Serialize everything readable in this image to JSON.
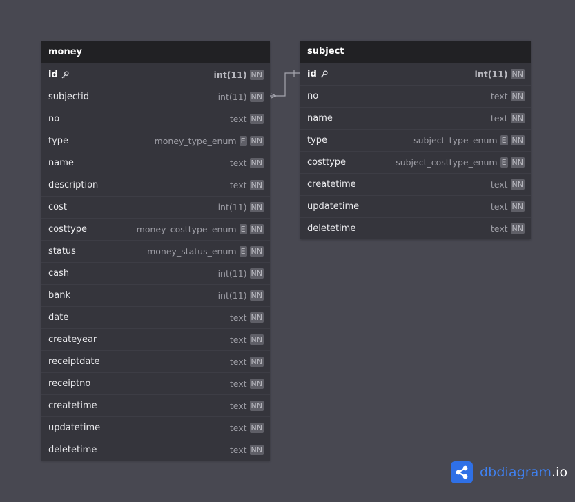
{
  "tables": [
    {
      "id": "money",
      "name": "money",
      "fields": [
        {
          "name": "id",
          "type": "int(11)",
          "pk": true,
          "enum": false,
          "nn": "NN"
        },
        {
          "name": "subjectid",
          "type": "int(11)",
          "pk": false,
          "enum": false,
          "nn": "NN"
        },
        {
          "name": "no",
          "type": "text",
          "pk": false,
          "enum": false,
          "nn": "NN"
        },
        {
          "name": "type",
          "type": "money_type_enum",
          "pk": false,
          "enum": true,
          "nn": "NN"
        },
        {
          "name": "name",
          "type": "text",
          "pk": false,
          "enum": false,
          "nn": "NN"
        },
        {
          "name": "description",
          "type": "text",
          "pk": false,
          "enum": false,
          "nn": "NN"
        },
        {
          "name": "cost",
          "type": "int(11)",
          "pk": false,
          "enum": false,
          "nn": "NN"
        },
        {
          "name": "costtype",
          "type": "money_costtype_enum",
          "pk": false,
          "enum": true,
          "nn": "NN"
        },
        {
          "name": "status",
          "type": "money_status_enum",
          "pk": false,
          "enum": true,
          "nn": "NN"
        },
        {
          "name": "cash",
          "type": "int(11)",
          "pk": false,
          "enum": false,
          "nn": "NN"
        },
        {
          "name": "bank",
          "type": "int(11)",
          "pk": false,
          "enum": false,
          "nn": "NN"
        },
        {
          "name": "date",
          "type": "text",
          "pk": false,
          "enum": false,
          "nn": "NN"
        },
        {
          "name": "createyear",
          "type": "text",
          "pk": false,
          "enum": false,
          "nn": "NN"
        },
        {
          "name": "receiptdate",
          "type": "text",
          "pk": false,
          "enum": false,
          "nn": "NN"
        },
        {
          "name": "receiptno",
          "type": "text",
          "pk": false,
          "enum": false,
          "nn": "NN"
        },
        {
          "name": "createtime",
          "type": "text",
          "pk": false,
          "enum": false,
          "nn": "NN"
        },
        {
          "name": "updatetime",
          "type": "text",
          "pk": false,
          "enum": false,
          "nn": "NN"
        },
        {
          "name": "deletetime",
          "type": "text",
          "pk": false,
          "enum": false,
          "nn": "NN"
        }
      ]
    },
    {
      "id": "subject",
      "name": "subject",
      "fields": [
        {
          "name": "id",
          "type": "int(11)",
          "pk": true,
          "enum": false,
          "nn": "NN"
        },
        {
          "name": "no",
          "type": "text",
          "pk": false,
          "enum": false,
          "nn": "NN"
        },
        {
          "name": "name",
          "type": "text",
          "pk": false,
          "enum": false,
          "nn": "NN"
        },
        {
          "name": "type",
          "type": "subject_type_enum",
          "pk": false,
          "enum": true,
          "nn": "NN"
        },
        {
          "name": "costtype",
          "type": "subject_costtype_enum",
          "pk": false,
          "enum": true,
          "nn": "NN"
        },
        {
          "name": "createtime",
          "type": "text",
          "pk": false,
          "enum": false,
          "nn": "NN"
        },
        {
          "name": "updatetime",
          "type": "text",
          "pk": false,
          "enum": false,
          "nn": "NN"
        },
        {
          "name": "deletetime",
          "type": "text",
          "pk": false,
          "enum": false,
          "nn": "NN"
        }
      ]
    }
  ],
  "enum_badge": "E",
  "relationship": {
    "from": "money.subjectid",
    "to": "subject.id",
    "from_end": "many",
    "to_end": "one"
  },
  "brand": {
    "name": "dbdiagram",
    "suffix": ".io",
    "icon": "share-nodes-icon"
  },
  "colors": {
    "background": "#484851",
    "table_body": "#35353c",
    "table_header": "#212124",
    "brand_blue": "#2f70e6"
  }
}
